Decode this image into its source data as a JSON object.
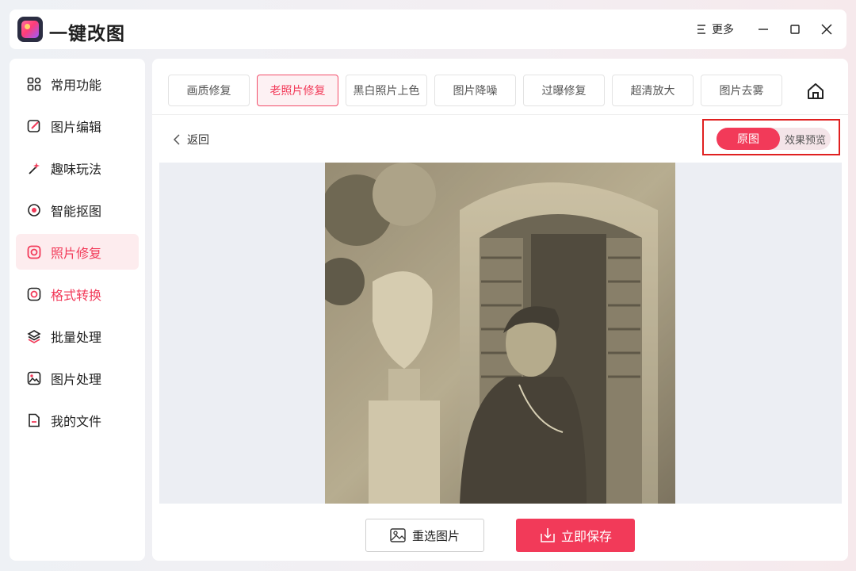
{
  "app": {
    "title": "一键改图",
    "more_label": "更多"
  },
  "sidebar": {
    "items": [
      {
        "label": "常用功能",
        "icon": "grid-icon"
      },
      {
        "label": "图片编辑",
        "icon": "edit-icon"
      },
      {
        "label": "趣味玩法",
        "icon": "magic-wand-icon"
      },
      {
        "label": "智能抠图",
        "icon": "target-icon"
      },
      {
        "label": "照片修复",
        "icon": "photo-repair-icon"
      },
      {
        "label": "格式转换",
        "icon": "convert-icon"
      },
      {
        "label": "批量处理",
        "icon": "layers-icon"
      },
      {
        "label": "图片处理",
        "icon": "image-icon"
      },
      {
        "label": "我的文件",
        "icon": "file-icon"
      }
    ],
    "active_index": 4
  },
  "tabs": [
    {
      "label": "画质修复"
    },
    {
      "label": "老照片修复"
    },
    {
      "label": "黑白照片上色"
    },
    {
      "label": "图片降噪"
    },
    {
      "label": "过曝修复"
    },
    {
      "label": "超清放大"
    },
    {
      "label": "图片去雾"
    }
  ],
  "active_tab": 1,
  "back_label": "返回",
  "compare": {
    "original_label": "原图",
    "effect_label": "效果预览",
    "selected": "原图"
  },
  "actions": {
    "reselect_label": "重选图片",
    "save_label": "立即保存"
  },
  "colors": {
    "accent": "#f23a59",
    "highlight_border": "#e02020",
    "canvas_bg": "#eceef3"
  }
}
